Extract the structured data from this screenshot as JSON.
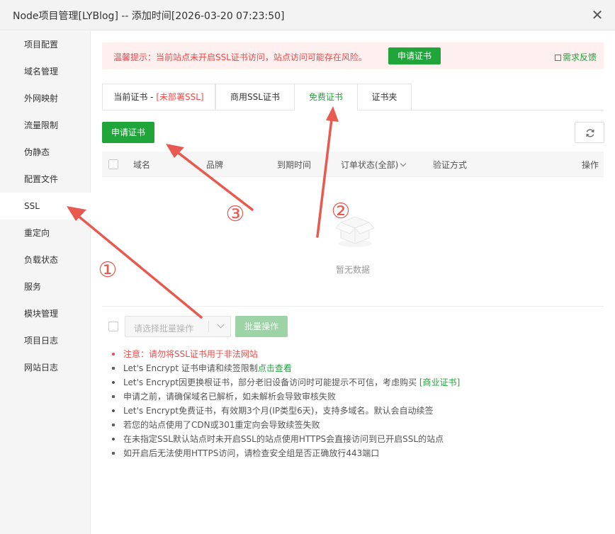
{
  "window": {
    "title": "Node项目管理[LYBlog] -- 添加时间[2026-03-20 07:23:50]",
    "close_icon": "close-icon"
  },
  "sidebar": {
    "items": [
      {
        "label": "项目配置"
      },
      {
        "label": "域名管理"
      },
      {
        "label": "外网映射"
      },
      {
        "label": "流量限制"
      },
      {
        "label": "伪静态"
      },
      {
        "label": "配置文件"
      },
      {
        "label": "SSL",
        "active": true
      },
      {
        "label": "重定向"
      },
      {
        "label": "负载状态"
      },
      {
        "label": "服务"
      },
      {
        "label": "模块管理"
      },
      {
        "label": "项目日志"
      },
      {
        "label": "网站日志"
      }
    ]
  },
  "alert": {
    "text": "温馨提示：当前站点未开启SSL证书访问，站点访问可能存在风险。",
    "button": "申请证书",
    "feedback": "需求反馈"
  },
  "tabs": [
    {
      "label": "当前证书 - ",
      "label_extra": "[未部署SSL]"
    },
    {
      "label": "商用SSL证书"
    },
    {
      "label": "免费证书",
      "active": true
    },
    {
      "label": "证书夹"
    }
  ],
  "toolbar": {
    "apply_button": "申请证书",
    "refresh_icon": "refresh-icon"
  },
  "table": {
    "columns": [
      "域名",
      "品牌",
      "到期时间",
      "订单状态(全部)",
      "验证方式",
      "操作"
    ],
    "empty_text": "暂无数据"
  },
  "batch": {
    "placeholder": "请选择批量操作",
    "button": "批量操作"
  },
  "tips": {
    "warn": "注意：请勿将SSL证书用于非法网站",
    "t1": "Let's Encrypt 证书申请和续签限制",
    "t1_link": "点击查看",
    "t2": "Let's Encrypt因更换根证书，部分老旧设备访问时可能提示不可信，考虑购买 ",
    "t2_link": "[商业证书]",
    "t3": "申请之前，请确保域名已解析，如未解析会导致审核失败",
    "t4": "Let's Encrypt免费证书，有效期3个月(IP类型6天)，支持多域名。默认会自动续签",
    "t5": "若您的站点使用了CDN或301重定向会导致续签失败",
    "t6": "在未指定SSL默认站点时未开启SSL的站点使用HTTPS会直接访问到已开启SSL的站点",
    "t7": "如开启后无法使用HTTPS访问，请检查安全组是否正确放行443端口"
  },
  "annotations": {
    "labels": [
      "①",
      "②",
      "③"
    ],
    "color": "#e8594f"
  },
  "colors": {
    "accent": "#20a53a",
    "warning": "#ef4a4a",
    "annotation": "#e8594f"
  }
}
